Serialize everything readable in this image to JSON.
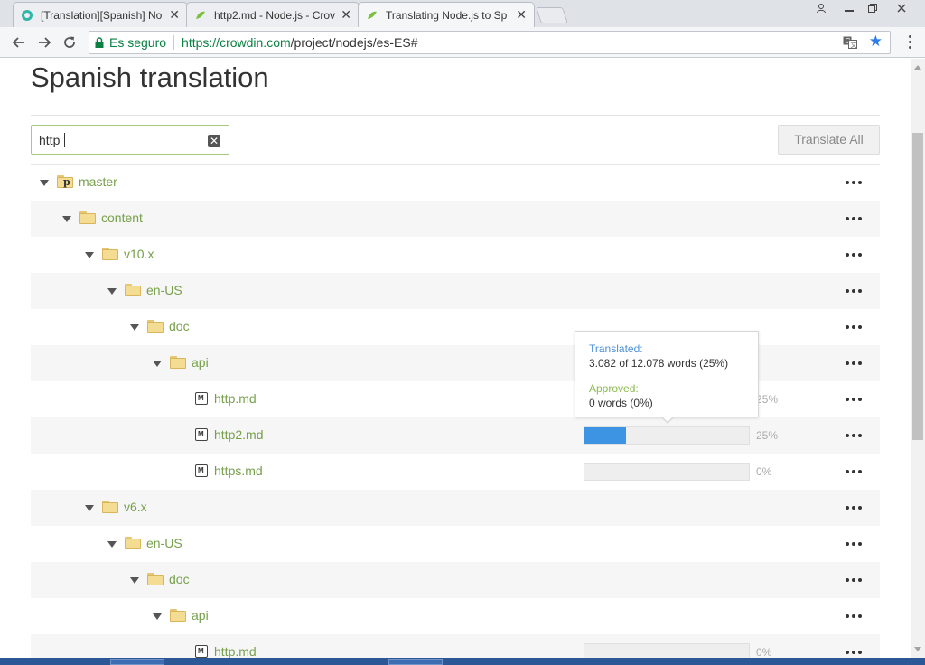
{
  "browser": {
    "tabs": [
      {
        "title": "[Translation][Spanish] No",
        "active": false
      },
      {
        "title": "http2.md - Node.js - Crov",
        "active": false
      },
      {
        "title": "Translating Node.js to Sp",
        "active": true
      }
    ],
    "secure_label": "Es seguro",
    "url_host": "https://crowdin.com",
    "url_path": "/project/nodejs/es-ES#",
    "icons": [
      "back-icon",
      "forward-icon",
      "reload-icon",
      "lock-icon",
      "translate-icon",
      "star-icon",
      "menu-icon"
    ]
  },
  "page": {
    "title": "Spanish translation",
    "search": {
      "value": "http",
      "placeholder": ""
    },
    "translate_all_label": "Translate All"
  },
  "tree": [
    {
      "name": "master",
      "type": "branch",
      "level": 0
    },
    {
      "name": "content",
      "type": "folder",
      "level": 1
    },
    {
      "name": "v10.x",
      "type": "folder",
      "level": 2
    },
    {
      "name": "en-US",
      "type": "folder",
      "level": 3
    },
    {
      "name": "doc",
      "type": "folder",
      "level": 4
    },
    {
      "name": "api",
      "type": "folder",
      "level": 5
    },
    {
      "name": "http.md",
      "type": "file",
      "level": 6,
      "progress": 25,
      "percent_label": "25%"
    },
    {
      "name": "http2.md",
      "type": "file",
      "level": 6,
      "progress": 25,
      "percent_label": "25%"
    },
    {
      "name": "https.md",
      "type": "file",
      "level": 6,
      "progress": 0,
      "percent_label": "0%"
    },
    {
      "name": "v6.x",
      "type": "folder",
      "level": 2
    },
    {
      "name": "en-US",
      "type": "folder",
      "level": 3
    },
    {
      "name": "doc",
      "type": "folder",
      "level": 4
    },
    {
      "name": "api",
      "type": "folder",
      "level": 5
    },
    {
      "name": "http.md",
      "type": "file",
      "level": 6,
      "progress": 0,
      "percent_label": "0%"
    }
  ],
  "tooltip": {
    "translated_label": "Translated:",
    "translated_value": "3.082 of 12.078 words (25%)",
    "approved_label": "Approved:",
    "approved_value": "0 words (0%)"
  },
  "colors": {
    "accent_green": "#77a04b",
    "progress_blue": "#3d94e2",
    "secure_green": "#0b8043"
  }
}
